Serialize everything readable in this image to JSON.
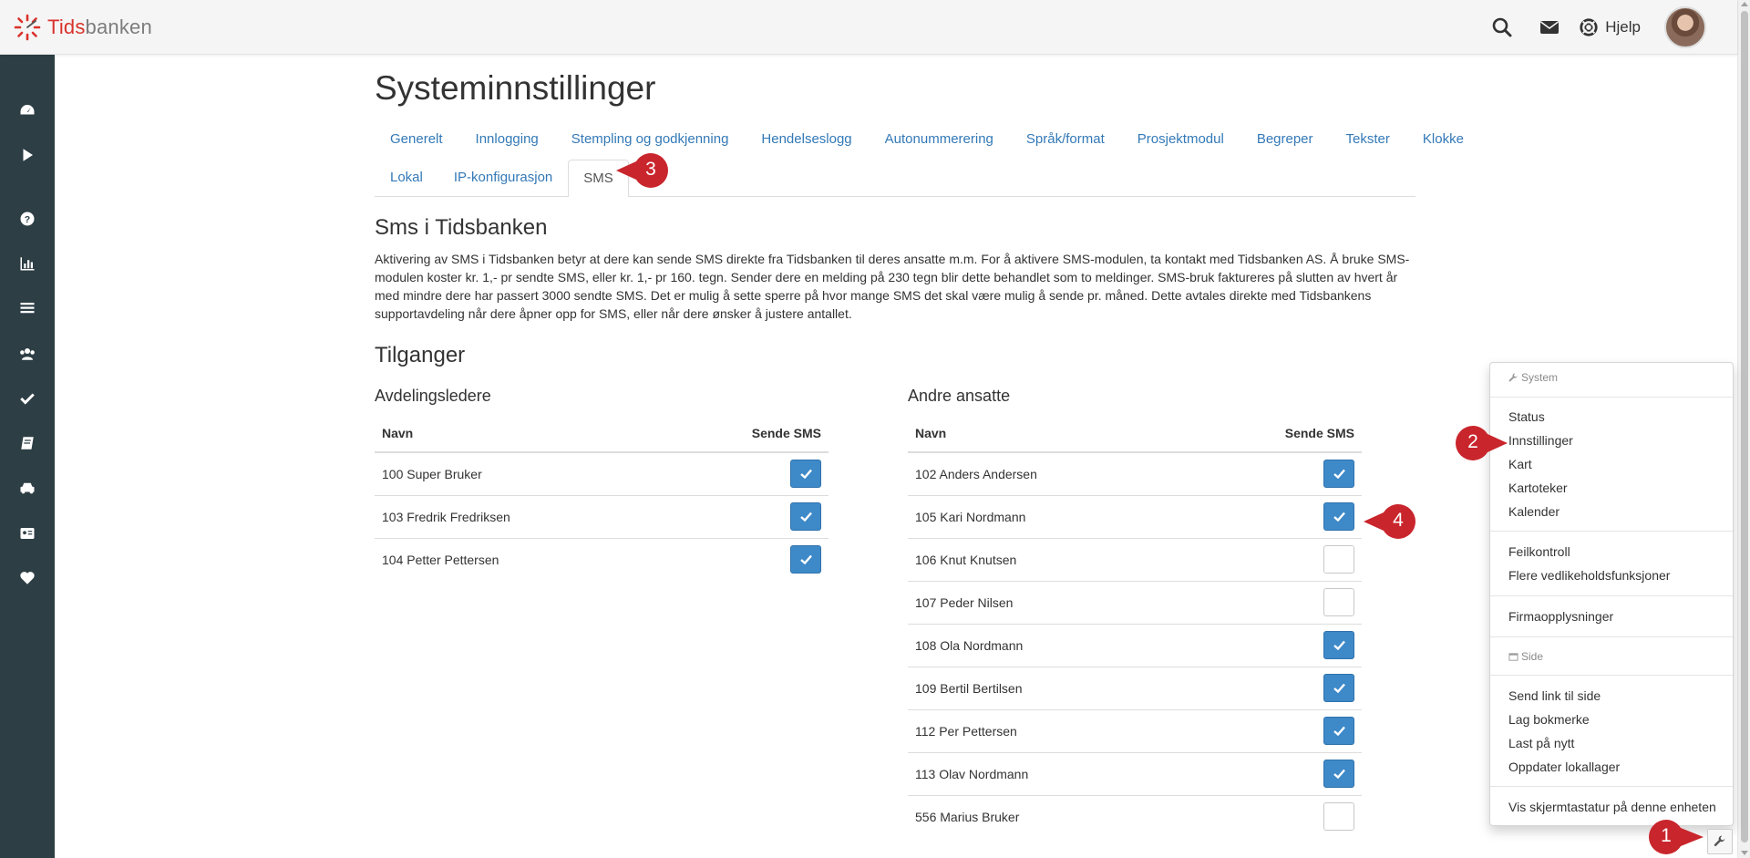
{
  "app": {
    "logo_part1": "Tids",
    "logo_part2": "banken",
    "help_label": "Hjelp"
  },
  "page": {
    "title": "Systeminnstillinger",
    "tabs_row1": [
      "Generelt",
      "Innlogging",
      "Stempling og godkjenning",
      "Hendelseslogg",
      "Autonummerering",
      "Språk/format",
      "Prosjektmodul",
      "Begreper",
      "Tekster",
      "Klokke"
    ],
    "tabs_row2": [
      "Lokal",
      "IP-konfigurasjon",
      "SMS"
    ],
    "active_tab": "SMS",
    "section_title": "Sms i Tidsbanken",
    "description": "Aktivering av SMS i Tidsbanken betyr at dere kan sende SMS direkte fra Tidsbanken til deres ansatte m.m. For å aktivere SMS-modulen, ta kontakt med Tidsbanken AS. Å bruke SMS-modulen koster kr. 1,- pr sendte SMS, eller kr. 1,- pr 160. tegn. Sender dere en melding på 230 tegn blir dette behandlet som to meldinger. SMS-bruk faktureres på slutten av hvert år med mindre dere har passert 3000 sendte SMS. Det er mulig å sette sperre på hvor mange SMS det skal være mulig å sende pr. måned. Dette avtales direkte med Tidsbankens supportavdeling når dere åpner opp for SMS, eller når dere ønsker å justere antallet.",
    "access_title": "Tilganger"
  },
  "managers": {
    "title": "Avdelingsledere",
    "col_name": "Navn",
    "col_sms": "Sende SMS",
    "rows": [
      {
        "name": "100 Super Bruker",
        "checked": true
      },
      {
        "name": "103 Fredrik Fredriksen",
        "checked": true
      },
      {
        "name": "104 Petter Pettersen",
        "checked": true
      }
    ]
  },
  "others": {
    "title": "Andre ansatte",
    "col_name": "Navn",
    "col_sms": "Sende SMS",
    "rows": [
      {
        "name": "102 Anders Andersen",
        "checked": true
      },
      {
        "name": "105 Kari Nordmann",
        "checked": true
      },
      {
        "name": "106 Knut Knutsen",
        "checked": false
      },
      {
        "name": "107 Peder Nilsen",
        "checked": false
      },
      {
        "name": "108 Ola Nordmann",
        "checked": true
      },
      {
        "name": "109 Bertil Bertilsen",
        "checked": true
      },
      {
        "name": "112 Per Pettersen",
        "checked": true
      },
      {
        "name": "113 Olav Nordmann",
        "checked": true
      },
      {
        "name": "556 Marius Bruker",
        "checked": false
      }
    ]
  },
  "menu": {
    "system_header": "System",
    "group1": [
      "Status",
      "Innstillinger",
      "Kart",
      "Kartoteker",
      "Kalender"
    ],
    "group2": [
      "Feilkontroll",
      "Flere vedlikeholdsfunksjoner"
    ],
    "group3": [
      "Firmaopplysninger"
    ],
    "side_header": "Side",
    "group4": [
      "Send link til side",
      "Lag bokmerke",
      "Last på nytt",
      "Oppdater lokallager"
    ],
    "group5": [
      "Vis skjermtastatur på denne enheten"
    ]
  },
  "callouts": [
    "1",
    "2",
    "3",
    "4"
  ],
  "colors": {
    "accent": "#3e89c8",
    "sidebar": "#2d3e45",
    "brand_red": "#d9322b",
    "callout": "#c9252c",
    "link": "#3379b7"
  }
}
